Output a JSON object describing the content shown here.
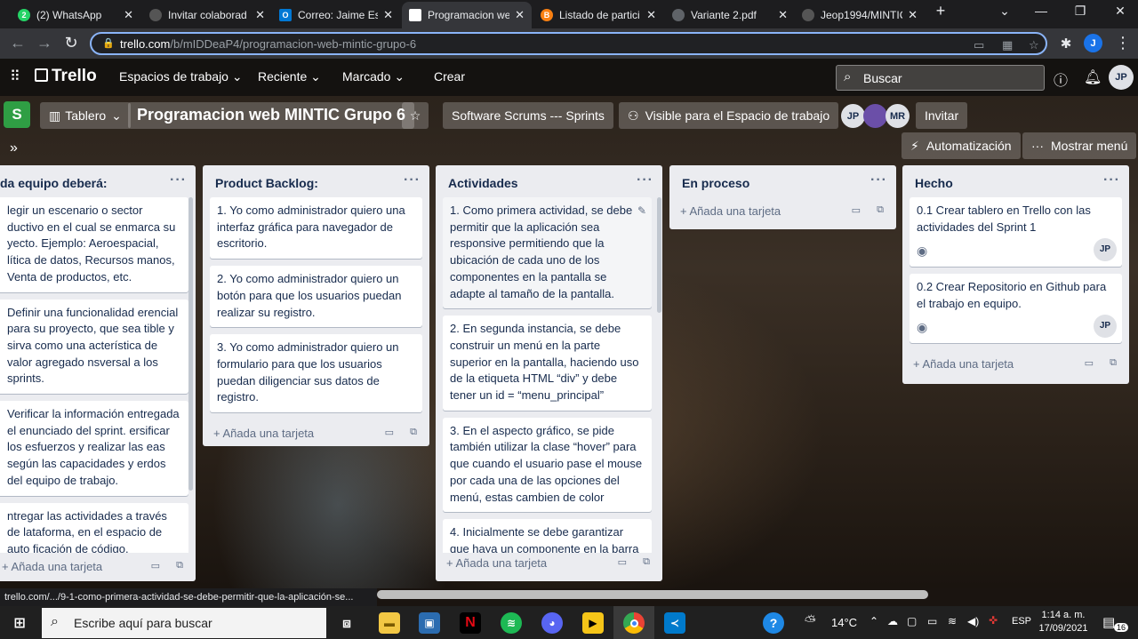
{
  "browser": {
    "tabs": [
      {
        "title": "(2) WhatsApp",
        "icon": "whatsapp-icon",
        "color": "#25d366",
        "badge": "2",
        "active": false
      },
      {
        "title": "Invitar colaborad",
        "icon": "github-icon",
        "color": "#ffffff",
        "active": false
      },
      {
        "title": "Correo: Jaime Est",
        "icon": "outlook-icon",
        "color": "#0078d4",
        "badge": "O",
        "active": false
      },
      {
        "title": "Programacion we",
        "icon": "trello-icon",
        "color": "#ffffff",
        "active": true
      },
      {
        "title": "Listado de partici",
        "icon": "moodle-icon",
        "color": "#f98012",
        "badge": "B",
        "active": false
      },
      {
        "title": "Variante 2.pdf",
        "icon": "globe-icon",
        "color": "#9aa0a6",
        "active": false
      },
      {
        "title": "Jeop1994/MINTIC",
        "icon": "github-icon",
        "color": "#ffffff",
        "active": false
      }
    ],
    "new_tab": "+",
    "url_host": "trello.com",
    "url_path": "/b/mIDDeaP4/programacion-web-mintic-grupo-6",
    "profile_initial": "J"
  },
  "trello": {
    "logo": "Trello",
    "nav": [
      "Espacios de trabajo",
      "Reciente",
      "Marcado",
      "Crear"
    ],
    "search_placeholder": "Buscar",
    "user_initials": "JP"
  },
  "board": {
    "space_letter": "S",
    "view_label": "Tablero",
    "title": "Programacion web MINTIC Grupo 6",
    "workspace": "Software Scrums --- Sprints",
    "visibility": "Visible para el Espacio de trabajo",
    "members": [
      "JP",
      "",
      "MR"
    ],
    "invite": "Invitar",
    "automation": "Automatización",
    "show_menu": "Mostrar menú",
    "add_card": "Añada una tarjeta"
  },
  "lists": [
    {
      "title": "da equipo deberá:",
      "cards": [
        {
          "text": "legir un escenario o sector ductivo en el cual se enmarca su yecto. Ejemplo: Aeroespacial, lítica de datos, Recursos manos, Venta de productos, etc."
        },
        {
          "text": "Definir una funcionalidad erencial para su proyecto, que sea tible y sirva como una acterística de valor agregado nsversal a los sprints."
        },
        {
          "text": "Verificar la información entregada el enunciado del sprint. ersificar los esfuerzos y realizar las eas según las capacidades y erdos del equipo de trabajo."
        },
        {
          "text": "ntregar las actividades a través de lataforma, en el espacio de auto ficación de código."
        }
      ]
    },
    {
      "title": "Product Backlog:",
      "cards": [
        {
          "text": "1. Yo como administrador quiero una interfaz gráfica para navegador de escritorio."
        },
        {
          "text": "2. Yo como administrador quiero un botón para que los usuarios puedan realizar su registro."
        },
        {
          "text": "3. Yo como administrador quiero un formulario para que los usuarios puedan diligenciar sus datos de registro."
        }
      ]
    },
    {
      "title": "Actividades",
      "cards": [
        {
          "text": "1. Como primera actividad, se debe permitir que la aplicación sea responsive permitiendo que la ubicación de cada uno de los componentes en la pantalla se adapte al tamaño de la pantalla."
        },
        {
          "text": "2. En segunda instancia, se debe construir un menú en la parte superior en la pantalla, haciendo uso de la etiqueta HTML “div” y debe tener un id = “menu_principal”"
        },
        {
          "text": "3. En el aspecto gráfico, se pide también utilizar la clase “hover” para que cuando el usuario pase el mouse por cada una de las opciones del menú, estas cambien de color"
        },
        {
          "text": "4. Inicialmente se debe garantizar que haya un componente en la barra"
        }
      ]
    },
    {
      "title": "En proceso",
      "cards": []
    },
    {
      "title": "Hecho",
      "cards": [
        {
          "text": "0.1 Crear tablero en Trello con las actividades del Sprint 1",
          "member": "JP"
        },
        {
          "text": "0.2 Crear Repositorio en Github para el trabajo en equipo.",
          "member": "JP"
        }
      ]
    }
  ],
  "status_url": "trello.com/.../9-1-como-primera-actividad-se-debe-permitir-que-la-aplicación-se...",
  "taskbar": {
    "search_placeholder": "Escribe aquí para buscar",
    "weather": "14°C",
    "language": "ESP",
    "time": "1:14 a. m.",
    "date": "17/09/2021",
    "notifications": "16"
  }
}
